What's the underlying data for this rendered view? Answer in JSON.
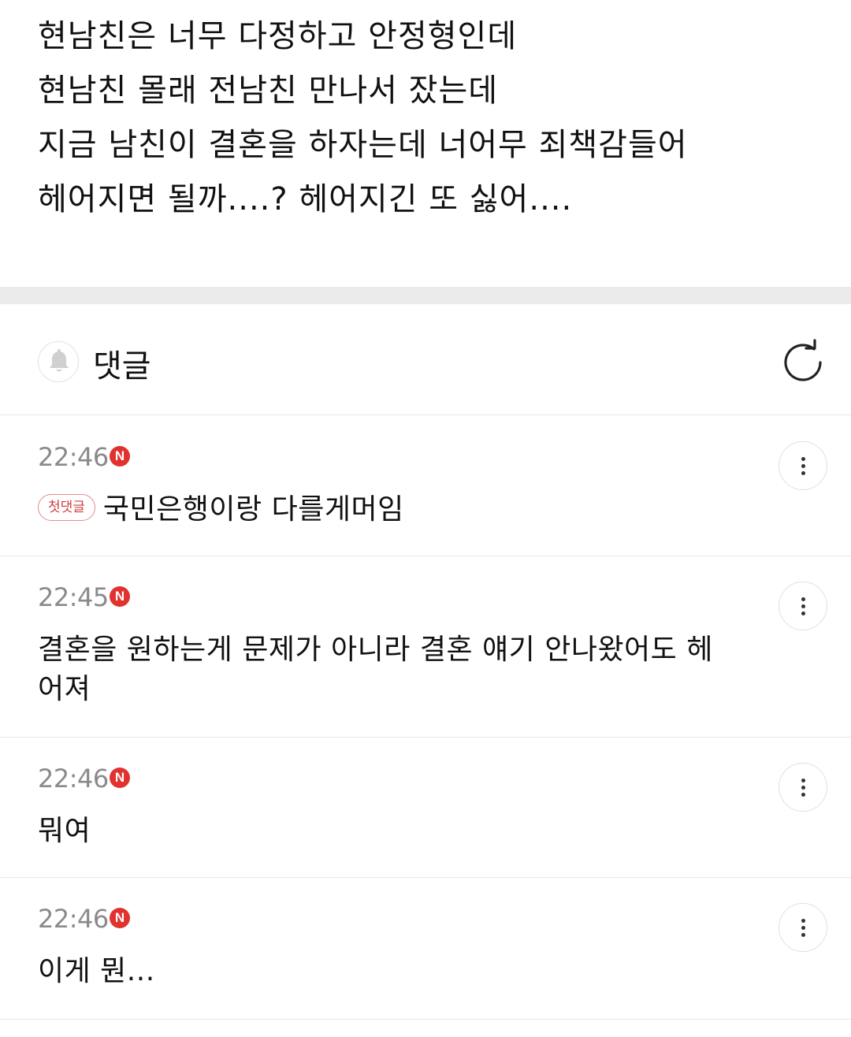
{
  "post": {
    "lines": [
      "현남친은 너무 다정하고 안정형인데",
      "현남친 몰래 전남친 만나서 잤는데",
      "지금 남친이 결혼을 하자는데 너어무 죄책감들어",
      "헤어지면 될까....? 헤어지긴 또 싫어...."
    ]
  },
  "comments_header": {
    "title": "댓글",
    "bell_icon": "bell-icon",
    "refresh_icon": "refresh-icon"
  },
  "comments": [
    {
      "time": "22:46",
      "new_badge": "N",
      "first_tag": "첫댓글",
      "text": "국민은행이랑 다를게머임"
    },
    {
      "time": "22:45",
      "new_badge": "N",
      "text_line1": "결혼을 원하는게 문제가 아니라 결혼 얘기 안나왔어도 헤",
      "text_line2": "어져"
    },
    {
      "time": "22:46",
      "new_badge": "N",
      "text": "뭐여"
    },
    {
      "time": "22:46",
      "new_badge": "N",
      "text": "이게 뭔..."
    }
  ],
  "colors": {
    "accent_badge": "#e0322f",
    "first_tag": "#d23c3c",
    "divider_band": "#ebebeb",
    "time_text": "#8a8a8a"
  }
}
